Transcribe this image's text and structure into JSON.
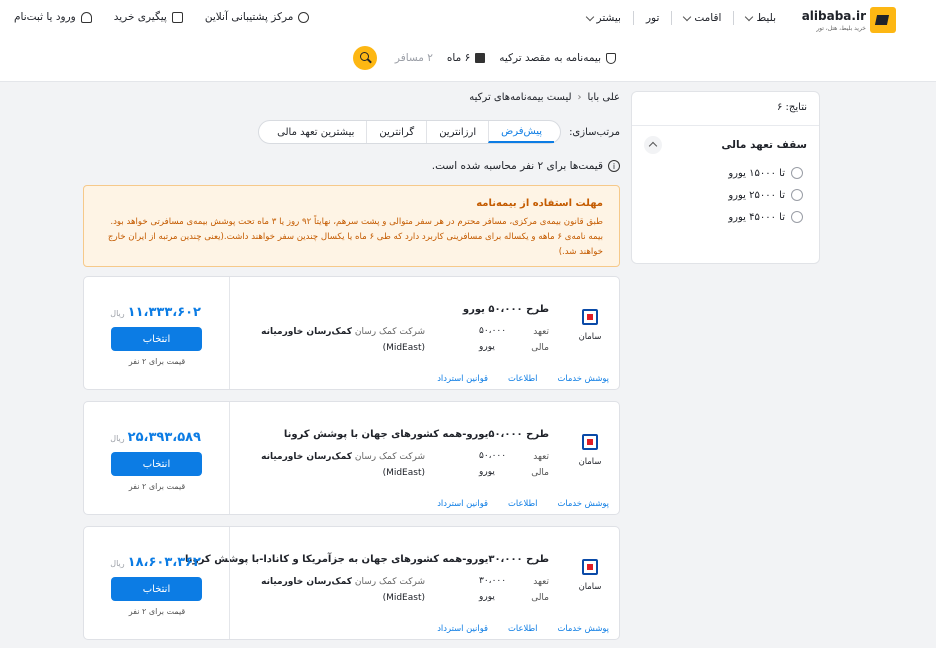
{
  "header": {
    "logo_name": "alibaba.ir",
    "logo_tagline": "خرید بلیط، هتل، تور",
    "nav": [
      {
        "label": "بلیط"
      },
      {
        "label": "اقامت"
      },
      {
        "label": "تور"
      },
      {
        "label": "بیشتر"
      }
    ],
    "support_label": "مرکز پشتیبانی آنلاین",
    "tracking_label": "پیگیری خرید",
    "login_label": "ورود یا ثبت‌نام"
  },
  "search": {
    "destination": "بیمه‌نامه به مقصد ترکیه",
    "duration": "۶ ماه",
    "passengers": "۲ مسافر"
  },
  "sidebar": {
    "results_count": "نتایج: ۶",
    "filter_title": "سقف تعهد مالی",
    "options": [
      {
        "label": "تا ۱۵۰۰۰ یورو"
      },
      {
        "label": "تا ۲۵۰۰۰ یورو"
      },
      {
        "label": "تا ۴۵۰۰۰ یورو"
      }
    ]
  },
  "breadcrumb": {
    "home": "علی بابا",
    "current": "لیست بیمه‌نامه‌های ترکیه"
  },
  "sort": {
    "label": "مرتب‌سازی:",
    "tabs": [
      {
        "label": "پیش‌فرض"
      },
      {
        "label": "ارزانترین"
      },
      {
        "label": "گرانترین"
      },
      {
        "label": "بیشترین تعهد مالی"
      }
    ]
  },
  "price_note": "قیمت‌ها برای ۲ نفر محاسبه شده است.",
  "alert": {
    "title": "مهلت استفاده از بیمه‌نامه",
    "line1": "طبق قانون بیمه‌ی مرکزی، مسافر محترم در هر سفر متوالی و پشت سرهم، نهایتاً ۹۲ روز یا ۳ ماه تحت پوشش بیمه‌ی مسافرتی خواهد بود.",
    "line2": "بیمه نامه‌ی ۶ ماهه و یکساله برای مسافرینی کاربرد دارد که طی ۶ ماه یا یکسال چندین سفر خواهند داشت.(یعنی چندین مرتبه از ایران خارج",
    "line3": "خواهند شد.)"
  },
  "card_labels": {
    "commitment": "تعهد",
    "financial": "مالی",
    "select": "انتخاب",
    "price_for": "قیمت برای ۲ نفر",
    "currency": "ریال",
    "company_prefix": "شرکت کمک رسان",
    "link_coverage": "پوشش خدمات",
    "link_info": "اطلاعات",
    "link_refund": "قوانین استرداد"
  },
  "plans": [
    {
      "title": "طرح ۵۰،۰۰۰ یورو",
      "amount": "۵۰،۰۰۰",
      "unit": "یورو",
      "company": "کمک‌رسان خاورمیانه",
      "company_en": "(MidEast)",
      "brand": "سامان",
      "price": "۱۱،۳۳۳،۶۰۲"
    },
    {
      "title": "طرح ۵۰،۰۰۰یورو-همه کشورهای جهان با پوشش کرونا",
      "amount": "۵۰،۰۰۰",
      "unit": "یورو",
      "company": "کمک‌رسان خاورمیانه",
      "company_en": "(MidEast)",
      "brand": "سامان",
      "price": "۲۵،۳۹۳،۵۸۹"
    },
    {
      "title": "طرح ۳۰،۰۰۰یورو-همه کشورهای جهان به جزآمریکا و کانادا-با پوشش کرونا",
      "amount": "۳۰،۰۰۰",
      "unit": "یورو",
      "company": "کمک‌رسان خاورمیانه",
      "company_en": "(MidEast)",
      "brand": "سامان",
      "price": "۱۸،۶۰۳،۳۶۲"
    }
  ]
}
